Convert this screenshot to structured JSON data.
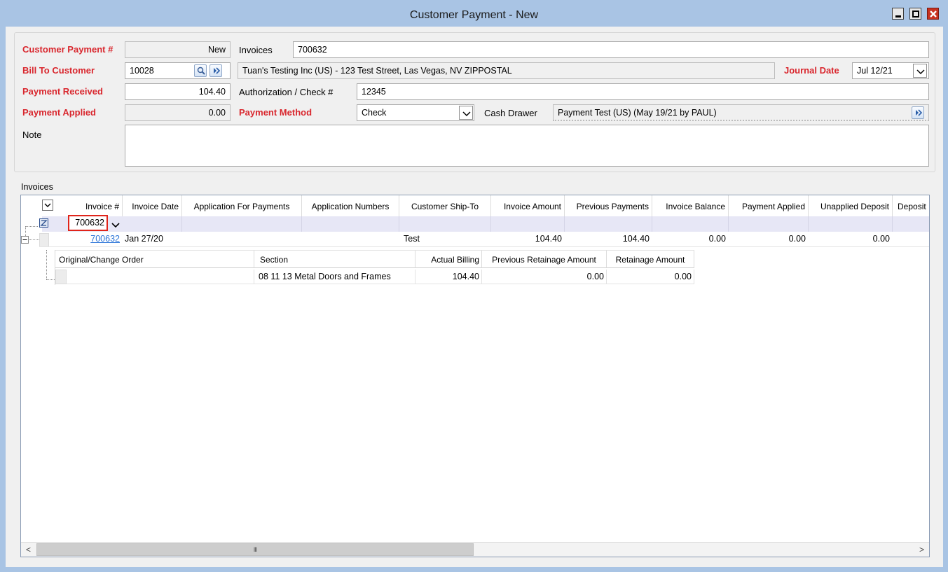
{
  "window": {
    "title": "Customer Payment - New"
  },
  "form": {
    "customer_payment_label": "Customer Payment #",
    "customer_payment_value": "New",
    "invoices_label": "Invoices",
    "invoices_value": "700632",
    "bill_to_label": "Bill To Customer",
    "bill_to_value": "10028",
    "customer_desc": "Tuan's Testing Inc (US) - 123 Test Street, Las Vegas, NV  ZIPPOSTAL",
    "journal_date_label": "Journal Date",
    "journal_date_value": "Jul 12/21",
    "payment_received_label": "Payment Received",
    "payment_received_value": "104.40",
    "auth_label": "Authorization / Check #",
    "auth_value": "12345",
    "payment_applied_label": "Payment Applied",
    "payment_applied_value": "0.00",
    "payment_method_label": "Payment Method",
    "payment_method_value": "Check",
    "cash_drawer_label": "Cash Drawer",
    "cash_drawer_value": "Payment Test (US) (May 19/21 by PAUL)",
    "note_label": "Note",
    "note_value": ""
  },
  "invoices_group": {
    "label": "Invoices",
    "columns": [
      "Invoice #",
      "Invoice Date",
      "Application For Payments",
      "Application Numbers",
      "Customer Ship-To",
      "Invoice Amount",
      "Previous Payments",
      "Invoice Balance",
      "Payment Applied",
      "Unapplied Deposit",
      "Deposit"
    ],
    "filter_invoice": "700632",
    "row": {
      "invoice": "700632",
      "date": "Jan 27/20",
      "application_for_payments": "",
      "application_numbers": "",
      "ship_to": "Test",
      "invoice_amount": "104.40",
      "previous_payments": "104.40",
      "invoice_balance": "0.00",
      "payment_applied": "0.00",
      "unapplied_deposit": "0.00"
    },
    "sub_columns": [
      "Original/Change Order",
      "Section",
      "Actual Billing",
      "Previous Retainage Amount",
      "Retainage Amount"
    ],
    "sub_row": {
      "change_order": "",
      "section": "08 11 13 Metal Doors and Frames",
      "actual_billing": "104.40",
      "previous_retainage": "0.00",
      "retainage": "0.00"
    }
  },
  "scrollbar": {
    "left_arrow": "<",
    "thumb_grip": "III",
    "right_arrow": ">"
  },
  "icons": [
    "minimize-icon",
    "maximize-icon",
    "close-icon",
    "search-icon",
    "lookup-icon",
    "chevron-down-icon",
    "filter-icon",
    "collapse-icon"
  ],
  "colors": {
    "required_label": "#d9272e",
    "link": "#2a74d8",
    "frame": "#a9c4e4",
    "close_button": "#c7311f"
  }
}
